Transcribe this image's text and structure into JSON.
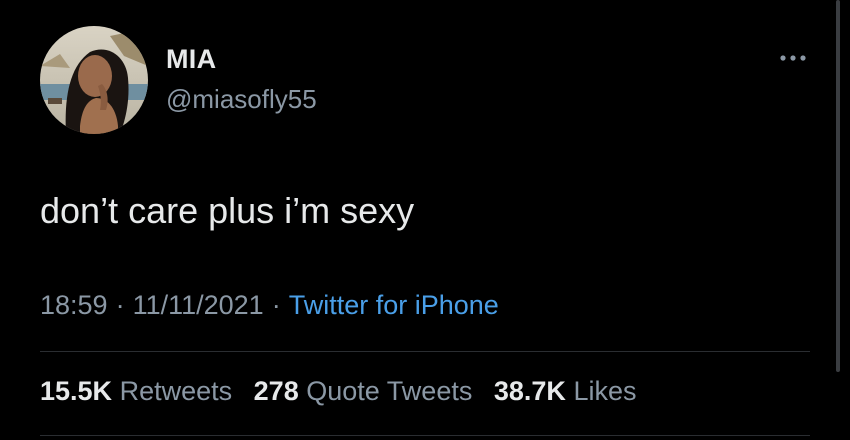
{
  "user": {
    "display_name": "MIA",
    "handle": "@miasofly55"
  },
  "tweet": {
    "text": "don’t care plus i’m sexy",
    "time": "18:59",
    "date": "11/11/2021",
    "separator": "·",
    "source": "Twitter for iPhone"
  },
  "stats": {
    "retweets_count": "15.5K",
    "retweets_label": "Retweets",
    "quotes_count": "278",
    "quotes_label": "Quote Tweets",
    "likes_count": "38.7K",
    "likes_label": "Likes"
  },
  "icons": {
    "more": "more-horizontal-icon",
    "avatar": "profile-photo"
  },
  "colors": {
    "background": "#000000",
    "primary_text": "#e7e9ea",
    "secondary_text": "#8b98a5",
    "link": "#4a9fe8"
  }
}
